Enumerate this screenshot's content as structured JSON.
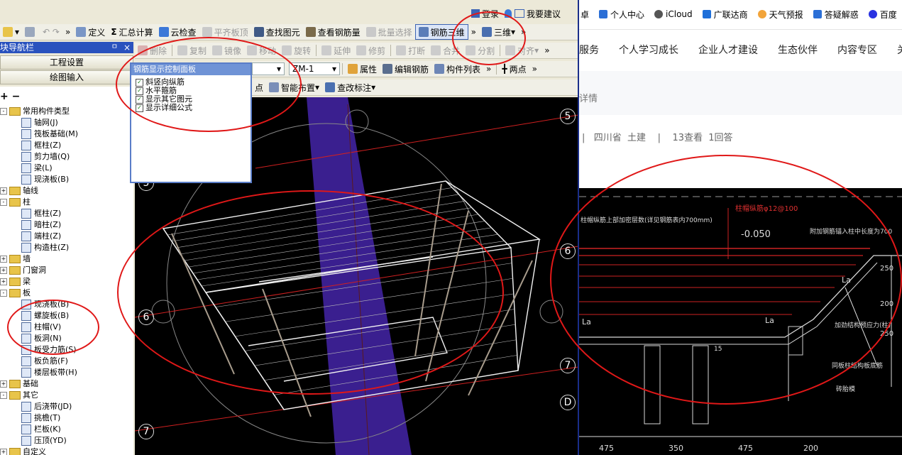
{
  "toolbar_top": {
    "buttons": [
      "定义",
      "汇总计算",
      "云检查",
      "平齐板顶",
      "查找图元",
      "查看钢筋量",
      "批量选择",
      "钢筋三维",
      "三维"
    ],
    "more": "»",
    "undo_redo": "↶ ↷"
  },
  "toolbar_edit": {
    "buttons": [
      "删除",
      "复制",
      "镜像",
      "移动",
      "旋转",
      "延伸",
      "修剪",
      "打断",
      "合并",
      "分割",
      "对齐"
    ],
    "more": "»"
  },
  "toolbar_prop": {
    "dropdown1": "",
    "dropdown2": "ZM-1",
    "buttons": [
      "属性",
      "编辑钢筋",
      "构件列表"
    ],
    "more": "»",
    "right_button": "两点"
  },
  "toolbar_draw": {
    "left_fragment": "点",
    "buttons": [
      "智能布置",
      "查改标注"
    ]
  },
  "login": {
    "login_label": "登录",
    "suggest_label": "我要建议"
  },
  "nav": {
    "title": "模块导航栏",
    "pin": "ㅁ",
    "close": "×",
    "btn_project": "工程设置",
    "btn_draw": "绘图输入",
    "tree_tools": "+ −"
  },
  "tree": [
    {
      "level": 0,
      "type": "folder",
      "exp": "-",
      "label": "常用构件类型"
    },
    {
      "level": 1,
      "type": "item",
      "label": "轴网(J)"
    },
    {
      "level": 1,
      "type": "item",
      "label": "筏板基础(M)"
    },
    {
      "level": 1,
      "type": "item",
      "label": "框柱(Z)"
    },
    {
      "level": 1,
      "type": "item",
      "label": "剪力墙(Q)"
    },
    {
      "level": 1,
      "type": "item",
      "label": "梁(L)"
    },
    {
      "level": 1,
      "type": "item",
      "label": "现浇板(B)"
    },
    {
      "level": 0,
      "type": "folder",
      "exp": "+",
      "label": "轴线"
    },
    {
      "level": 0,
      "type": "folder",
      "exp": "-",
      "label": "柱"
    },
    {
      "level": 1,
      "type": "item",
      "label": "框柱(Z)"
    },
    {
      "level": 1,
      "type": "item",
      "label": "暗柱(Z)"
    },
    {
      "level": 1,
      "type": "item",
      "label": "端柱(Z)"
    },
    {
      "level": 1,
      "type": "item",
      "label": "构造柱(Z)"
    },
    {
      "level": 0,
      "type": "folder",
      "exp": "+",
      "label": "墙"
    },
    {
      "level": 0,
      "type": "folder",
      "exp": "+",
      "label": "门窗洞"
    },
    {
      "level": 0,
      "type": "folder",
      "exp": "+",
      "label": "梁"
    },
    {
      "level": 0,
      "type": "folder",
      "exp": "-",
      "label": "板"
    },
    {
      "level": 1,
      "type": "item",
      "label": "现浇板(B)"
    },
    {
      "level": 1,
      "type": "item",
      "label": "螺旋板(B)"
    },
    {
      "level": 1,
      "type": "item",
      "label": "柱帽(V)"
    },
    {
      "level": 1,
      "type": "item",
      "label": "板洞(N)"
    },
    {
      "level": 1,
      "type": "item",
      "label": "板受力筋(S)"
    },
    {
      "level": 1,
      "type": "item",
      "label": "板负筋(F)"
    },
    {
      "level": 1,
      "type": "item",
      "label": "楼层板带(H)"
    },
    {
      "level": 0,
      "type": "folder",
      "exp": "+",
      "label": "基础"
    },
    {
      "level": 0,
      "type": "folder",
      "exp": "-",
      "label": "其它"
    },
    {
      "level": 1,
      "type": "item",
      "label": "后浇带(JD)"
    },
    {
      "level": 1,
      "type": "item",
      "label": "挑檐(T)"
    },
    {
      "level": 1,
      "type": "item",
      "label": "栏板(K)"
    },
    {
      "level": 1,
      "type": "item",
      "label": "压顶(YD)"
    },
    {
      "level": 0,
      "type": "folder",
      "exp": "+",
      "label": "自定义"
    }
  ],
  "rebar_panel": {
    "title": "钢筋显示控制面板",
    "options": [
      "斜竖向纵筋",
      "水平箍筋",
      "显示其它图元",
      "显示详细公式"
    ],
    "check": "✓"
  },
  "axes": [
    "5",
    "6",
    "6",
    "7",
    "7",
    "D",
    "5"
  ],
  "browser": {
    "bookmarks": [
      "个人中心",
      "iCloud",
      "广联达商",
      "天气预报",
      "答疑解惑",
      "百度"
    ],
    "bookmark_fragment": "卓",
    "nav": [
      "服务",
      "个人学习成长",
      "企业人才建设",
      "生态伙伴",
      "内容专区"
    ],
    "nav_fragment": "关",
    "detail": "详情",
    "meta": "|   四川省  土建    |    13查看  1回答"
  },
  "cad_drawing": {
    "top_note": "柱帽纵筋φ12@100",
    "elev": "-0.050",
    "left_note": "柱帽纵筋上部加密层数(详见钢筋表内700mm)",
    "right_note": "附加钢筋锚入柱中长度为700",
    "la1": "La",
    "la2": "La",
    "la3": "La",
    "dim_v1": "250",
    "dim_v2": "200",
    "dim_v3": "250",
    "dim_small": "15",
    "label_r1": "加劲结构预应力(柱)",
    "label_r2": "同板柱结构板底筋",
    "label_r3": "砖胎模",
    "bottom_dims": [
      "475",
      "350",
      "475",
      "200"
    ]
  },
  "colors": {
    "accent": "#2a52be",
    "ellipse": "#e01818",
    "canvas_bg": "#000000",
    "column": "#3a1f8f"
  }
}
